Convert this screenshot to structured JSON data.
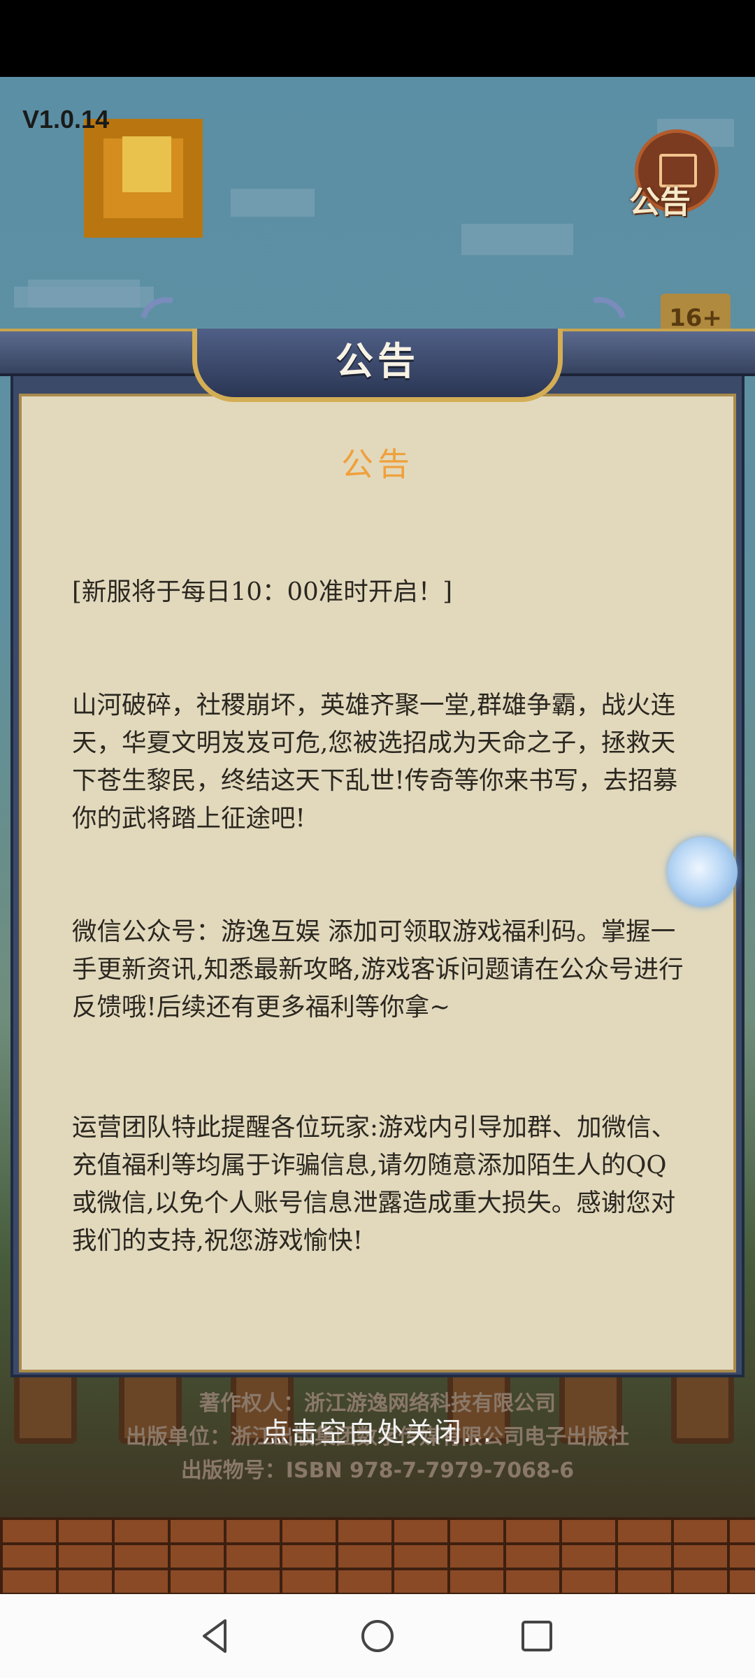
{
  "game": {
    "version": "V1.0.14",
    "notice_icon_label": "公告",
    "age_rating": "16+"
  },
  "dialog": {
    "header_title": "公告",
    "heading": "公告",
    "paragraphs": [
      "[新服将于每日10：00准时开启！]",
      "山河破碎，社稷崩坏，英雄齐聚一堂,群雄争霸，战火连天，华夏文明岌岌可危,您被选招成为天命之子，拯救天下苍生黎民，终结这天下乱世!传奇等你来书写，去招募你的武将踏上征途吧!",
      "微信公众号：游逸互娱 添加可领取游戏福利码。掌握一手更新资讯,知悉最新攻略,游戏客诉问题请在公众号进行反馈哦!后续还有更多福利等你拿~",
      "运营团队特此提醒各位玩家:游戏内引导加群、加微信、充值福利等均属于诈骗信息,请勿随意添加陌生人的QQ或微信,以免个人账号信息泄露造成重大损失。感谢您对我们的支持,祝您游戏愉快!"
    ],
    "close_hint": "点击空白处关闭..."
  },
  "credits": {
    "copyright_owner": "著作权人：浙江游逸网络科技有限公司",
    "publisher": "出版单位：浙江出版集团数字传媒有限公司电子出版社",
    "isbn": "出版物号：ISBN 978-7-7979-7068-6"
  },
  "navigation": {
    "back_icon": "triangle-back-icon",
    "home_icon": "circle-home-icon",
    "recents_icon": "square-recents-icon"
  }
}
